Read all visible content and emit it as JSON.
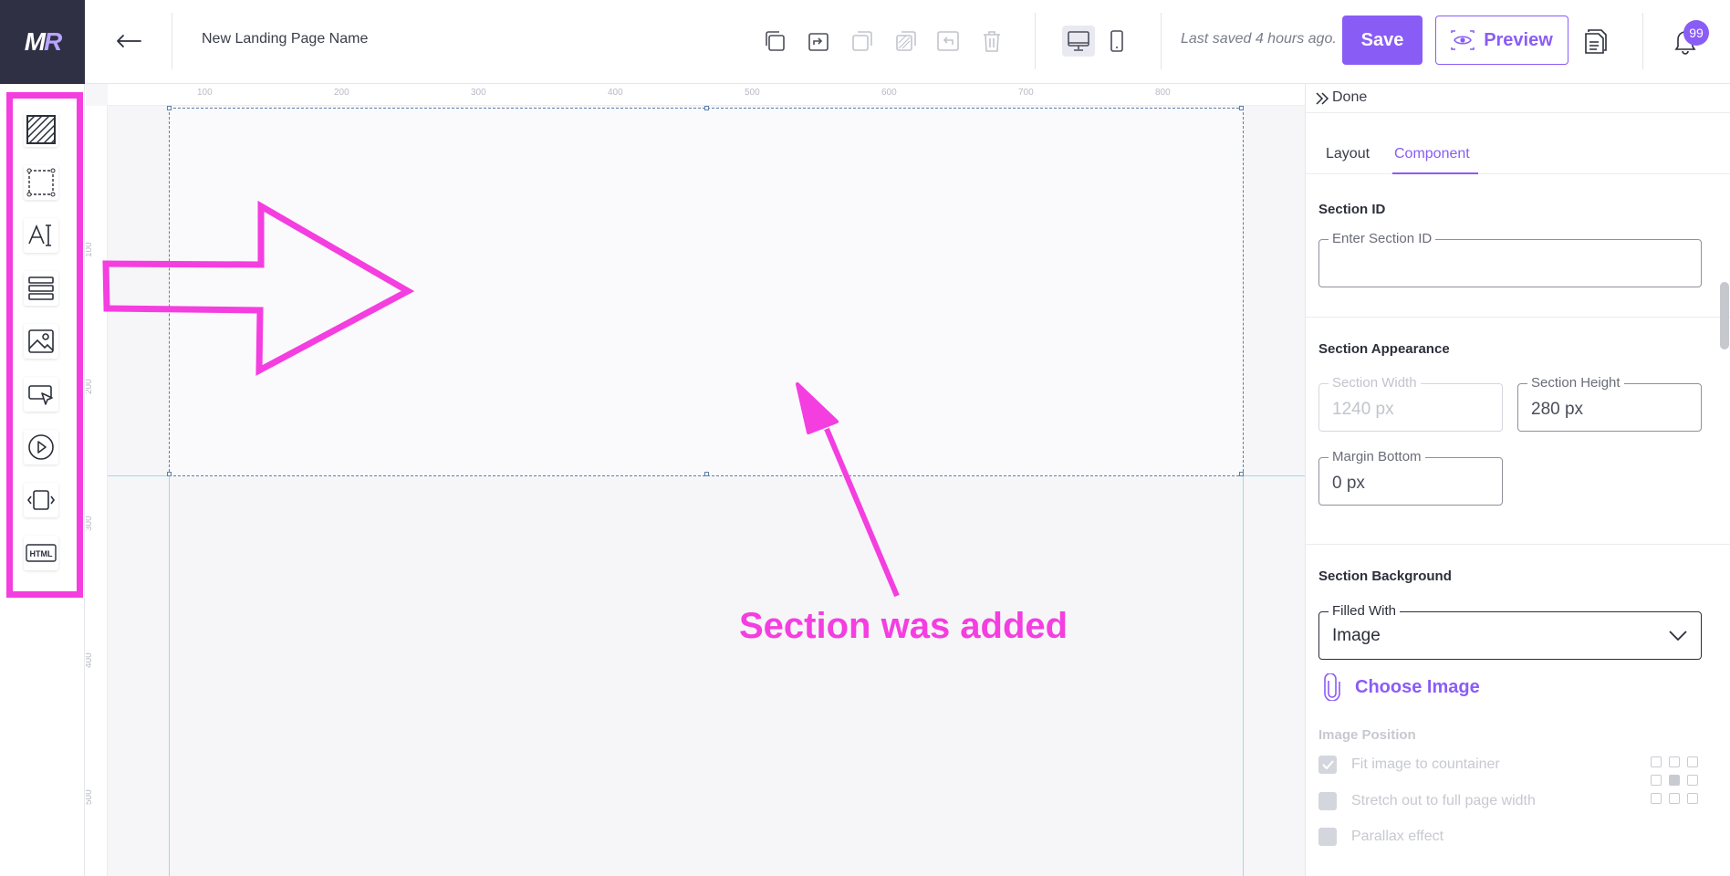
{
  "header": {
    "logo_main": "M",
    "logo_accent": "R",
    "page_name": "New Landing Page Name",
    "last_saved": "Last saved 4 hours ago.",
    "save_label": "Save",
    "preview_label": "Preview",
    "notification_count": "99"
  },
  "toolbar_icons": [
    "copy-icon",
    "redo-icon",
    "paste-icon",
    "style-icon",
    "undo-icon",
    "trash-icon",
    "desktop-icon",
    "mobile-icon",
    "pages-icon",
    "bell-icon"
  ],
  "left_tools": [
    "section-tool",
    "container-tool",
    "text-tool",
    "list-tool",
    "image-tool",
    "button-tool",
    "video-tool",
    "slider-tool",
    "html-tool"
  ],
  "left_tool_html_label": "HTML",
  "canvas": {
    "ruler_top": [
      "100",
      "200",
      "300",
      "400",
      "500",
      "600",
      "700",
      "800"
    ],
    "ruler_left": [
      "100",
      "200",
      "300",
      "400",
      "500"
    ],
    "annotation": "Section was added"
  },
  "panel": {
    "done_label": "Done",
    "tabs": [
      "Layout",
      "Component"
    ],
    "active_tab": "Component",
    "section_id": {
      "title": "Section ID",
      "label": "Enter Section ID",
      "value": ""
    },
    "appearance": {
      "title": "Section Appearance",
      "width_label": "Section Width",
      "width_value": "1240 px",
      "height_label": "Section Height",
      "height_value": "280 px",
      "margin_label": "Margin Bottom",
      "margin_value": "0 px"
    },
    "background": {
      "title": "Section Background",
      "filled_label": "Filled With",
      "filled_value": "Image",
      "choose_image": "Choose Image",
      "image_position_title": "Image Position",
      "options": [
        {
          "label": "Fit image to countainer",
          "checked": true
        },
        {
          "label": "Stretch out to full page width",
          "checked": false
        },
        {
          "label": "Parallax effect",
          "checked": false
        }
      ]
    }
  },
  "colors": {
    "accent": "#8a5cf6",
    "annotation": "#f43ee0",
    "logo_bg": "#2f3044"
  }
}
